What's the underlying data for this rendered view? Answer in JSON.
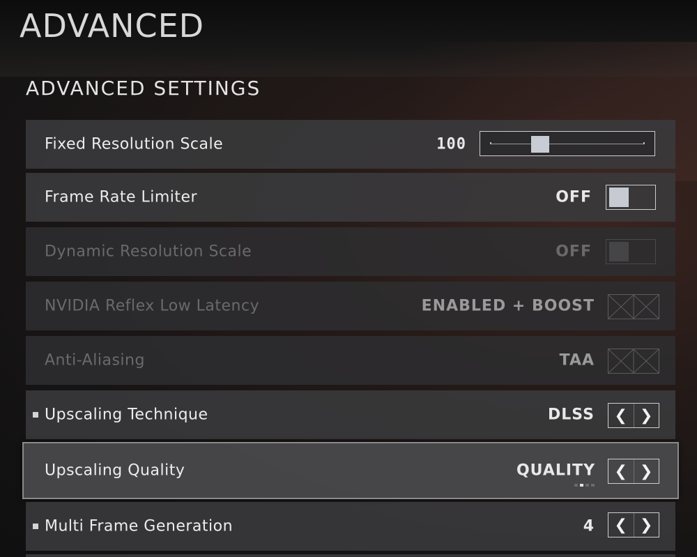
{
  "page": {
    "title": "ADVANCED",
    "section": "ADVANCED SETTINGS"
  },
  "rows": [
    {
      "label": "Fixed Resolution Scale",
      "value": "100",
      "control": "slider",
      "slider_fraction": 0.3
    },
    {
      "label": "Frame Rate Limiter",
      "value": "OFF",
      "control": "toggle"
    },
    {
      "label": "Dynamic Resolution Scale",
      "value": "OFF",
      "control": "toggle",
      "disabled": true
    },
    {
      "label": "NVIDIA Reflex Low Latency",
      "value": "ENABLED + BOOST",
      "control": "arrows-disabled",
      "disabled": true
    },
    {
      "label": "Anti-Aliasing",
      "value": "TAA",
      "control": "arrows-disabled",
      "disabled": true
    },
    {
      "label": "Upscaling Technique",
      "value": "DLSS",
      "control": "arrows",
      "bullet": true
    },
    {
      "label": "Upscaling Quality",
      "value": "QUALITY",
      "control": "arrows",
      "selected": true,
      "option_index": 1,
      "option_count": 4
    },
    {
      "label": "Multi Frame Generation",
      "value": "4",
      "control": "arrows",
      "bullet": true
    }
  ],
  "icons": {
    "left": "chevron-left-icon",
    "right": "chevron-right-icon",
    "disabled": "crossed-box-icon"
  },
  "colors": {
    "panel": "#3a3a3c",
    "selected_border": "#8a8a8a",
    "text": "#e8e8e8",
    "disabled_text": "#6a6a6a"
  }
}
